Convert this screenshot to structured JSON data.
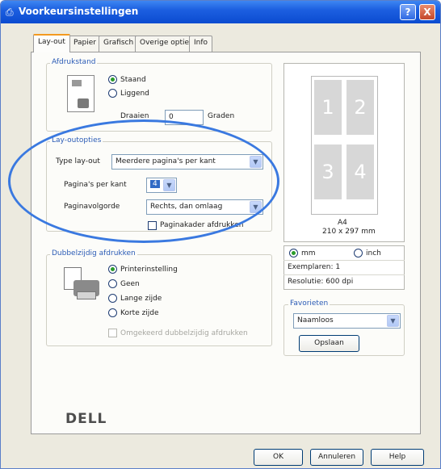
{
  "window": {
    "title": "Voorkeursinstellingen",
    "help_btn": "?",
    "close_btn": "X"
  },
  "tabs": [
    {
      "label": "Lay-out"
    },
    {
      "label": "Papier"
    },
    {
      "label": "Grafisch"
    },
    {
      "label": "Overige opties"
    },
    {
      "label": "Info"
    }
  ],
  "orientation": {
    "label": "Afdrukstand",
    "options": [
      "Staand",
      "Liggend"
    ],
    "selected": "Staand",
    "rotate_label": "Draaien",
    "rotate_value": "0",
    "rotate_unit": "Graden"
  },
  "layout_options": {
    "label": "Lay-outopties",
    "type_label": "Type lay-out",
    "type_value": "Meerdere pagina's per kant",
    "pages_label": "Pagina's per kant",
    "pages_value": "4",
    "order_label": "Paginavolgorde",
    "order_value": "Rechts, dan omlaag",
    "border_label": "Paginakader afdrukken"
  },
  "duplex": {
    "label": "Dubbelzijdig afdrukken",
    "options": [
      "Printerinstelling",
      "Geen",
      "Lange zijde",
      "Korte zijde"
    ],
    "selected": "Printerinstelling",
    "reverse_label": "Omgekeerd dubbelzijdig afdrukken"
  },
  "preview": {
    "pages": [
      "1",
      "2",
      "3",
      "4"
    ],
    "paper_name": "A4",
    "paper_size": "210 x 297 mm"
  },
  "units": {
    "options": [
      "mm",
      "inch"
    ],
    "selected": "mm"
  },
  "info": {
    "copies": "Exemplaren: 1",
    "resolution": "Resolutie: 600 dpi"
  },
  "favorites": {
    "label": "Favorieten",
    "value": "Naamloos",
    "save_label": "Opslaan"
  },
  "brand": "DELL",
  "footer": {
    "ok": "OK",
    "cancel": "Annuleren",
    "help": "Help"
  },
  "colors": {
    "titlebar": "#0b4bd0",
    "annotation_ellipse": "#3a79e0",
    "active_tab_accent": "#f39a1f"
  }
}
